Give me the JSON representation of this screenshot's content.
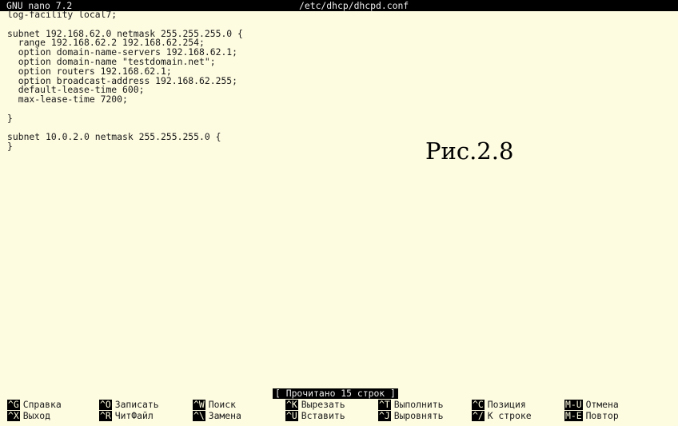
{
  "titlebar": {
    "app": "GNU nano 7.2",
    "file": "/etc/dhcp/dhcpd.conf"
  },
  "editor": {
    "lines": [
      "log-facility local7;",
      "",
      "subnet 192.168.62.0 netmask 255.255.255.0 {",
      "  range 192.168.62.2 192.168.62.254;",
      "  option domain-name-servers 192.168.62.1;",
      "  option domain-name \"testdomain.net\";",
      "  option routers 192.168.62.1;",
      "  option broadcast-address 192.168.62.255;",
      "  default-lease-time 600;",
      "  max-lease-time 7200;",
      "",
      "}",
      "",
      "subnet 10.0.2.0 netmask 255.255.255.0 {",
      "}"
    ]
  },
  "caption": "Рис.2.8",
  "status": "[ Прочитано 15 строк ]",
  "shortcuts": [
    {
      "key": "^G",
      "label": "Справка"
    },
    {
      "key": "^O",
      "label": "Записать"
    },
    {
      "key": "^W",
      "label": "Поиск"
    },
    {
      "key": "^K",
      "label": "Вырезать"
    },
    {
      "key": "^T",
      "label": "Выполнить"
    },
    {
      "key": "^C",
      "label": "Позиция"
    },
    {
      "key": "M-U",
      "label": "Отмена"
    },
    {
      "key": "^X",
      "label": "Выход"
    },
    {
      "key": "^R",
      "label": "ЧитФайл"
    },
    {
      "key": "^\\",
      "label": "Замена"
    },
    {
      "key": "^U",
      "label": "Вставить"
    },
    {
      "key": "^J",
      "label": "Выровнять"
    },
    {
      "key": "^/",
      "label": "К строке"
    },
    {
      "key": "M-E",
      "label": "Повтор"
    }
  ]
}
